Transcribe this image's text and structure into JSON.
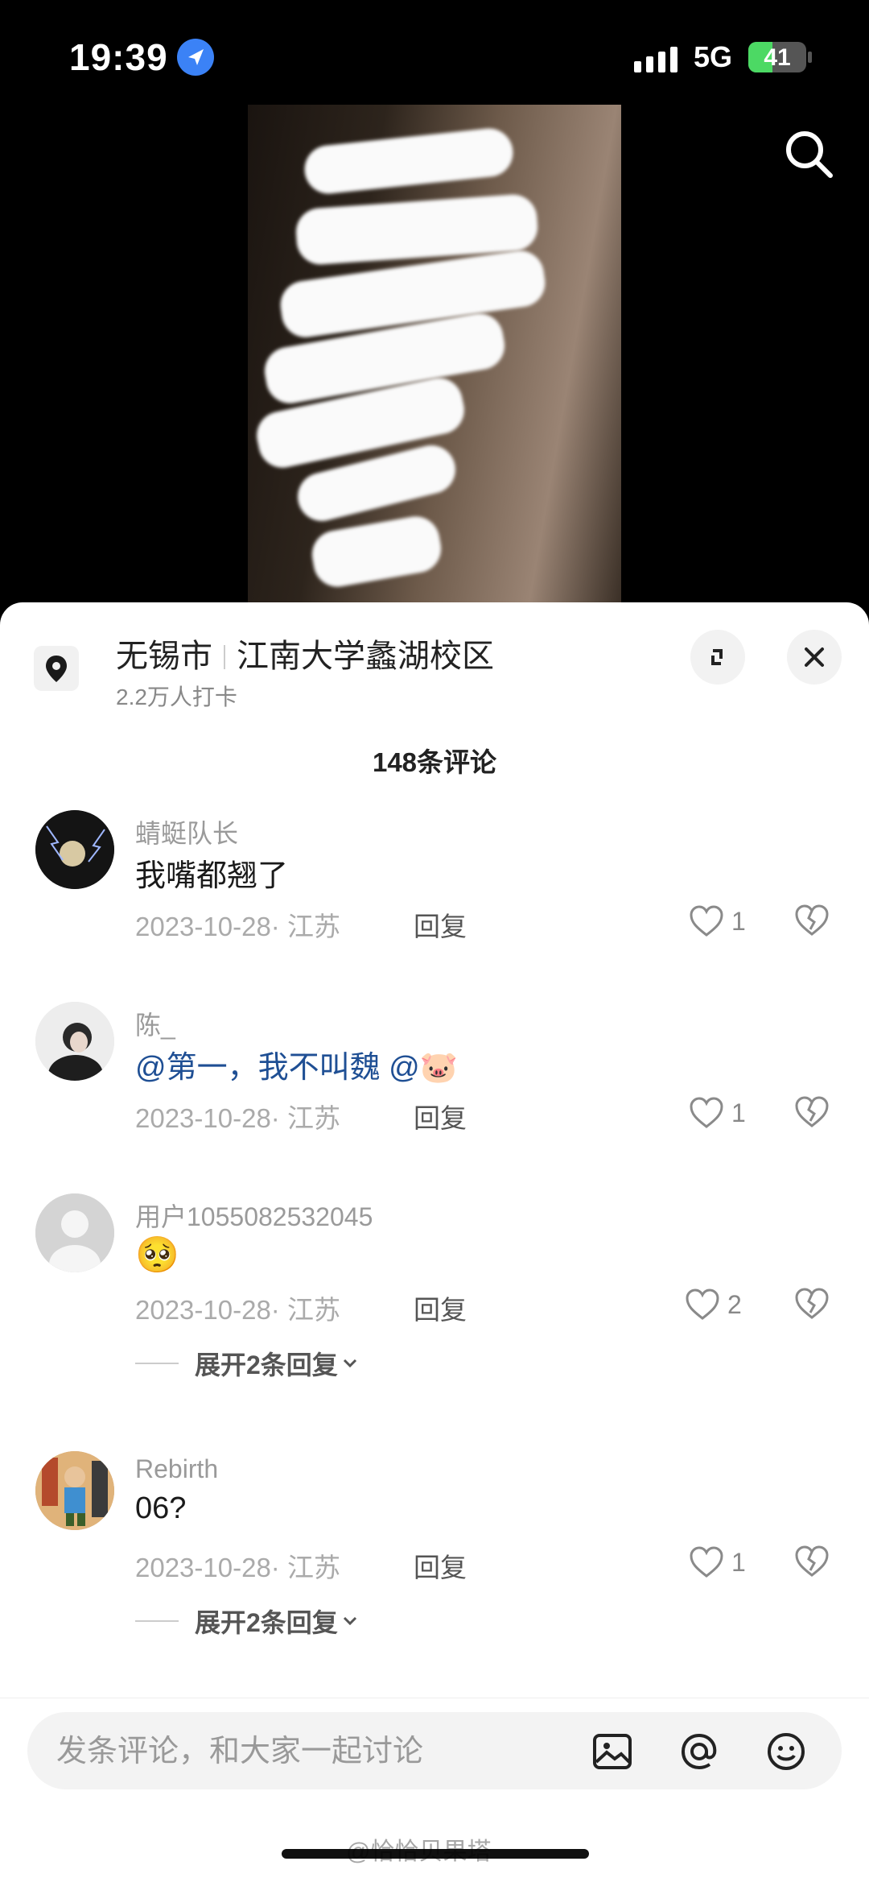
{
  "status_bar": {
    "time": "19:39",
    "network": "5G",
    "battery_level": "41",
    "battery_fraction": 0.41
  },
  "location": {
    "city": "无锡市",
    "place": "江南大学蠡湖校区",
    "checkins": "2.2万人打卡"
  },
  "comment_count": "148条评论",
  "comments": [
    {
      "user": "蜻蜓队长",
      "text": "我嘴都翘了",
      "date": "2023-10-28· 江苏",
      "reply": "回复",
      "likes": "1",
      "avatar_color": "#1a1a1a"
    },
    {
      "user": "陈_",
      "text_mention": "@第一，我不叫魏 @",
      "emoji": "🐷",
      "date": "2023-10-28· 江苏",
      "reply": "回复",
      "likes": "1",
      "avatar_color": "#d9d9d9"
    },
    {
      "user": "用户1055082532045",
      "emoji": "🥺",
      "date": "2023-10-28· 江苏",
      "reply": "回复",
      "likes": "2",
      "expand": "展开2条回复",
      "avatar_color": "#cfcfcf"
    },
    {
      "user": "Rebirth",
      "text": "06?",
      "date": "2023-10-28· 江苏",
      "reply": "回复",
      "likes": "1",
      "expand": "展开2条回复",
      "avatar_color": "#c9a070"
    }
  ],
  "input": {
    "placeholder": "发条评论，和大家一起讨论"
  },
  "watermark": "@恰恰贝果塔",
  "icons": [
    "location-arrow-icon",
    "search-icon",
    "map-pin-icon",
    "expand-icon",
    "close-icon",
    "heart-icon",
    "broken-heart-icon",
    "image-icon",
    "at-icon",
    "emoji-icon"
  ]
}
